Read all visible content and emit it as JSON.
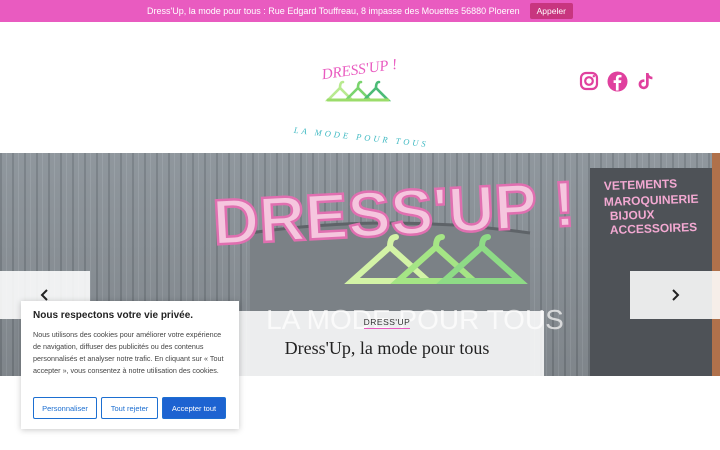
{
  "topbar": {
    "text": "Dress'Up, la mode pour tous : Rue Edgard Touffreau, 8 impasse des Mouettes 56880 Ploeren",
    "call_label": "Appeler"
  },
  "logo": {
    "brand": "DRESS'UP !",
    "tagline": "LA MODE POUR TOUS"
  },
  "socials": [
    "instagram-icon",
    "facebook-icon",
    "tiktok-icon"
  ],
  "hero": {
    "sign_title": "DRESS'UP !",
    "sign_lines": [
      "VETEMENTS",
      "MAROQUINERIE",
      "BIJOUX",
      "ACCESSOIRES"
    ],
    "sign_sub": "LA MODE POUR TOUS",
    "caption_kicker": "DRESS'UP",
    "caption_title": "Dress'Up, la mode pour tous"
  },
  "cookie": {
    "title": "Nous respectons votre vie privée.",
    "body": "Nous utilisons des cookies pour améliorer votre expérience de navigation, diffuser des publicités ou des contenus personnalisés et analyser notre trafic. En cliquant sur « Tout accepter », vous consentez à notre utilisation des cookies.",
    "customize_label": "Personnaliser",
    "reject_label": "Tout rejeter",
    "accept_label": "Accepter tout"
  },
  "colors": {
    "brand_pink": "#e95bc0",
    "accent_green": "#9bdc6a",
    "accept_blue": "#1d63d1"
  }
}
